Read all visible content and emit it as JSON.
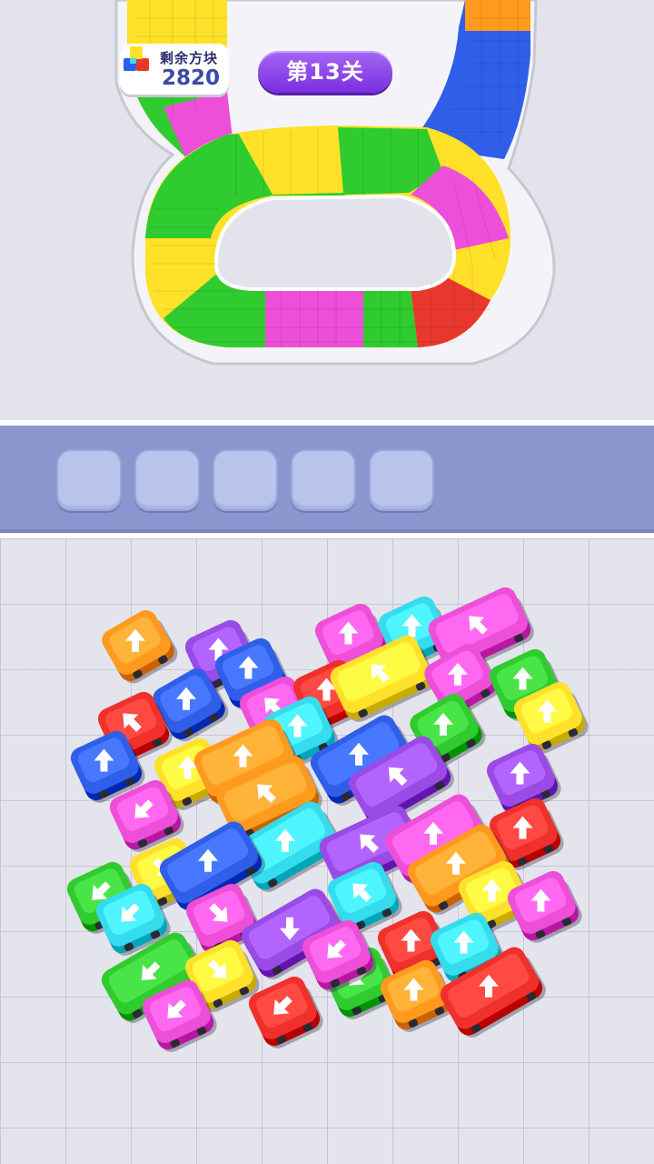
{
  "hud": {
    "blocks_label": "剩余方块",
    "blocks_remaining": "2820",
    "level_label": "第13关"
  },
  "slots": [
    {
      "filled": false
    },
    {
      "filled": false
    },
    {
      "filled": false
    },
    {
      "filled": false
    },
    {
      "filled": false
    }
  ],
  "colors": {
    "orange": "#ff9a1f",
    "purple": "#9a4be6",
    "magenta": "#ee4fd8",
    "blue": "#2f5fe8",
    "green": "#2fcb2f",
    "yellow": "#ffe12a",
    "red": "#f0302a",
    "cyan": "#35dcee",
    "track_red": "#e8382e",
    "track_blue": "#2f5fe8"
  },
  "track": {
    "segment_colors": [
      "yellow",
      "green",
      "magenta",
      "yellow",
      "green",
      "yellow",
      "magenta",
      "yellow",
      "red",
      "green",
      "magenta",
      "green",
      "yellow",
      "blue",
      "orange"
    ]
  },
  "vehicles": [
    {
      "color": "orange",
      "direction": "up",
      "kind": "car"
    },
    {
      "color": "purple",
      "direction": "up",
      "kind": "car"
    },
    {
      "color": "blue",
      "direction": "up",
      "kind": "car"
    },
    {
      "color": "magenta",
      "direction": "up",
      "kind": "car"
    },
    {
      "color": "cyan",
      "direction": "up",
      "kind": "car"
    },
    {
      "color": "magenta",
      "direction": "up-left",
      "kind": "bus"
    },
    {
      "color": "blue",
      "direction": "up",
      "kind": "car"
    },
    {
      "color": "magenta",
      "direction": "up-left",
      "kind": "car"
    },
    {
      "color": "red",
      "direction": "up",
      "kind": "car"
    },
    {
      "color": "yellow",
      "direction": "up-left",
      "kind": "bus"
    },
    {
      "color": "magenta",
      "direction": "up",
      "kind": "car"
    },
    {
      "color": "green",
      "direction": "up",
      "kind": "car"
    },
    {
      "color": "red",
      "direction": "up-left",
      "kind": "car"
    },
    {
      "color": "cyan",
      "direction": "up",
      "kind": "car"
    },
    {
      "color": "green",
      "direction": "up",
      "kind": "car"
    },
    {
      "color": "yellow",
      "direction": "up",
      "kind": "car"
    },
    {
      "color": "blue",
      "direction": "up",
      "kind": "car"
    },
    {
      "color": "yellow",
      "direction": "up",
      "kind": "car"
    },
    {
      "color": "orange",
      "direction": "up",
      "kind": "bus"
    },
    {
      "color": "blue",
      "direction": "up",
      "kind": "bus"
    },
    {
      "color": "purple",
      "direction": "up-left",
      "kind": "bus"
    },
    {
      "color": "purple",
      "direction": "up",
      "kind": "car"
    },
    {
      "color": "magenta",
      "direction": "down-left",
      "kind": "car"
    },
    {
      "color": "orange",
      "direction": "up-left",
      "kind": "bus"
    },
    {
      "color": "cyan",
      "direction": "up",
      "kind": "bus"
    },
    {
      "color": "purple",
      "direction": "up-left",
      "kind": "bus"
    },
    {
      "color": "magenta",
      "direction": "up",
      "kind": "bus"
    },
    {
      "color": "red",
      "direction": "up",
      "kind": "car"
    },
    {
      "color": "yellow",
      "direction": "down-right",
      "kind": "car"
    },
    {
      "color": "green",
      "direction": "down-left",
      "kind": "car"
    },
    {
      "color": "blue",
      "direction": "up",
      "kind": "bus"
    },
    {
      "color": "cyan",
      "direction": "up-left",
      "kind": "car"
    },
    {
      "color": "orange",
      "direction": "up",
      "kind": "bus"
    },
    {
      "color": "yellow",
      "direction": "up",
      "kind": "car"
    },
    {
      "color": "cyan",
      "direction": "down-left",
      "kind": "car"
    },
    {
      "color": "magenta",
      "direction": "down-right",
      "kind": "car"
    },
    {
      "color": "purple",
      "direction": "down",
      "kind": "bus"
    },
    {
      "color": "magenta",
      "direction": "up",
      "kind": "car"
    },
    {
      "color": "green",
      "direction": "down-left",
      "kind": "bus"
    },
    {
      "color": "yellow",
      "direction": "down-right",
      "kind": "car"
    },
    {
      "color": "magenta",
      "direction": "down-left",
      "kind": "car"
    },
    {
      "color": "green",
      "direction": "down-left",
      "kind": "car"
    },
    {
      "color": "red",
      "direction": "up",
      "kind": "car"
    },
    {
      "color": "cyan",
      "direction": "up",
      "kind": "car"
    },
    {
      "color": "magenta",
      "direction": "down-left",
      "kind": "car"
    },
    {
      "color": "red",
      "direction": "down-left",
      "kind": "car"
    },
    {
      "color": "orange",
      "direction": "up",
      "kind": "car"
    },
    {
      "color": "red",
      "direction": "up",
      "kind": "bus"
    }
  ]
}
